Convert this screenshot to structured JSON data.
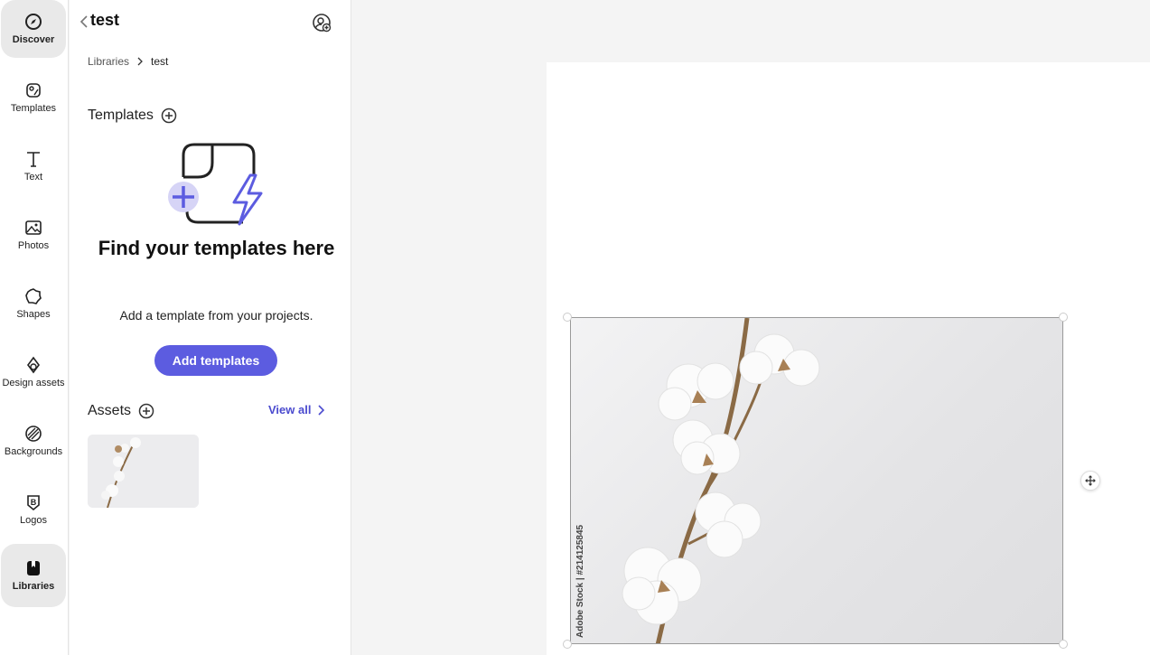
{
  "rail": {
    "items": [
      {
        "label": "Discover",
        "icon": "discover-icon",
        "active": true
      },
      {
        "label": "Templates",
        "icon": "templates-icon",
        "active": false
      },
      {
        "label": "Text",
        "icon": "text-icon",
        "active": false
      },
      {
        "label": "Photos",
        "icon": "photos-icon",
        "active": false
      },
      {
        "label": "Shapes",
        "icon": "shapes-icon",
        "active": false
      },
      {
        "label": "Design assets",
        "icon": "design-assets-icon",
        "active": false
      },
      {
        "label": "Backgrounds",
        "icon": "backgrounds-icon",
        "active": false
      },
      {
        "label": "Logos",
        "icon": "logos-icon",
        "active": false
      },
      {
        "label": "Libraries",
        "icon": "libraries-icon",
        "active": true
      }
    ]
  },
  "panel": {
    "title": "test",
    "breadcrumb": {
      "root": "Libraries",
      "current": "test"
    },
    "templates_heading": "Templates",
    "empty_title": "Find your templates here",
    "empty_subtitle": "Add a template from your projects.",
    "add_templates_label": "Add templates",
    "assets_heading": "Assets",
    "view_all_label": "View all"
  },
  "canvas": {
    "photo_watermark": "Adobe Stock | #214125845"
  },
  "colors": {
    "accent": "#5c5ce0",
    "link": "#4b4bcf",
    "rail_active_bg": "#e9e9e9"
  }
}
